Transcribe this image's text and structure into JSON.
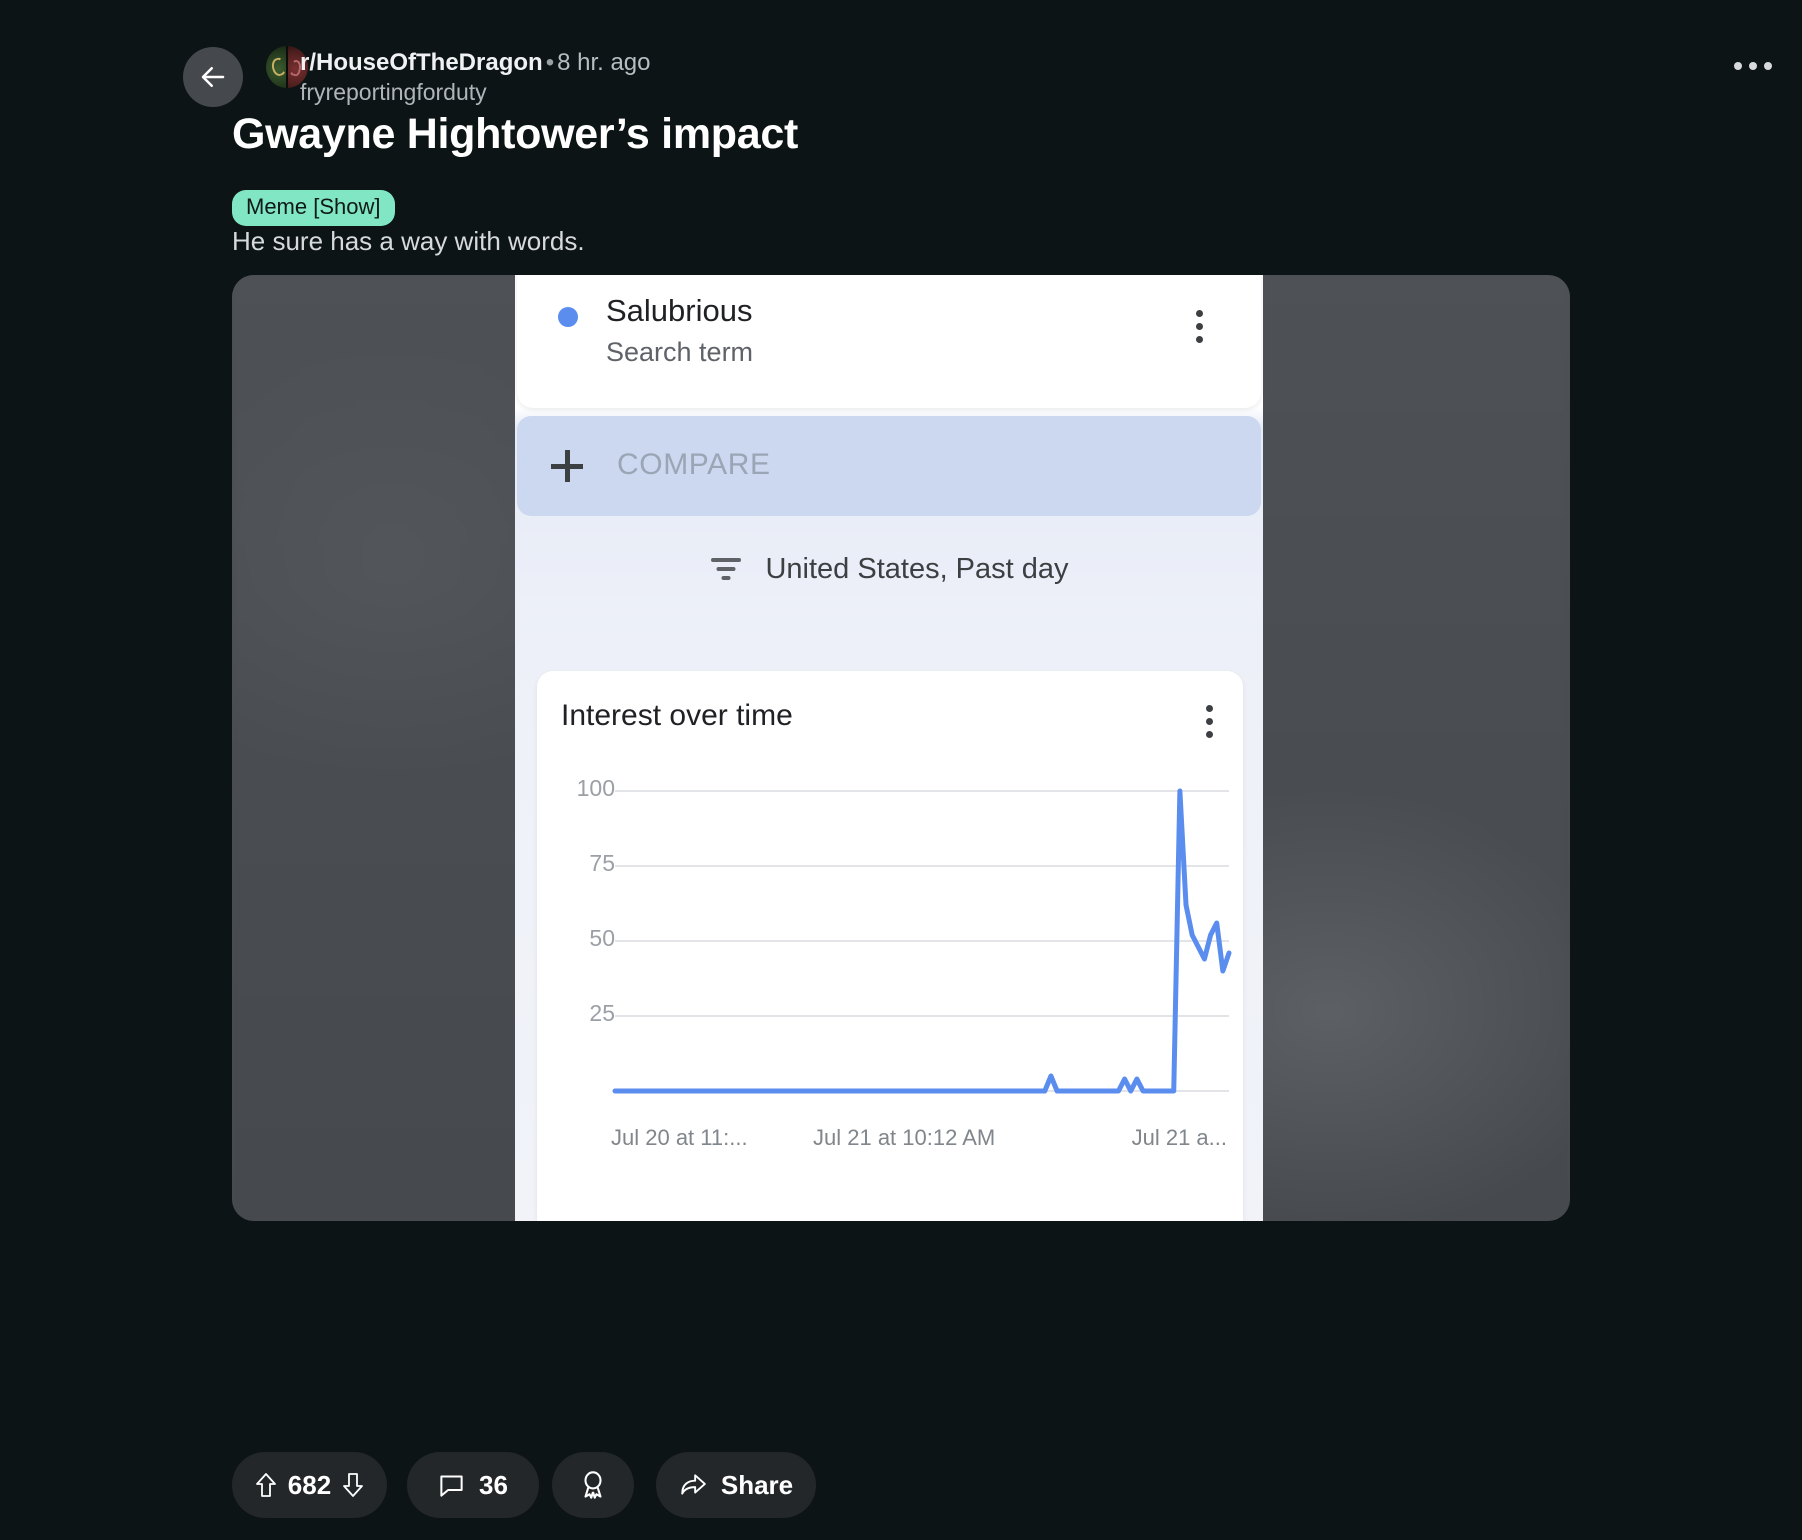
{
  "header": {
    "back_icon": "arrow-left-icon",
    "subreddit": "r/HouseOfTheDragon",
    "separator": "•",
    "age": "8 hr. ago",
    "author": "fryreportingforduty",
    "overflow_icon": "more-horizontal-icon"
  },
  "post": {
    "title": "Gwayne Hightower’s impact",
    "flair": "Meme [Show]",
    "body": "He sure has a way with words.",
    "flair_color": "#81e6c4"
  },
  "trends": {
    "term": {
      "name": "Salubrious",
      "subtitle": "Search term",
      "dot_color": "#5b8def",
      "menu_icon": "more-vertical-icon"
    },
    "compare": {
      "plus_icon": "plus-icon",
      "label": "COMPARE"
    },
    "filter": {
      "icon": "filter-icon",
      "label": "United States, Past day"
    },
    "chart_card": {
      "title": "Interest over time",
      "menu_icon": "more-vertical-icon"
    }
  },
  "chart_data": {
    "type": "line",
    "title": "Interest over time",
    "xlabel": "",
    "ylabel": "",
    "ylim": [
      0,
      100
    ],
    "yticks": [
      100,
      75,
      50,
      25
    ],
    "xticks": [
      "Jul 20 at 11:...",
      "Jul 21 at 10:12 AM",
      "Jul 21 a..."
    ],
    "grid": true,
    "legend": "Salubrious",
    "line_color": "#5b8def",
    "series": [
      {
        "name": "Salubrious",
        "values": [
          0,
          0,
          0,
          0,
          0,
          0,
          0,
          0,
          0,
          0,
          0,
          0,
          0,
          0,
          0,
          0,
          0,
          0,
          0,
          0,
          0,
          0,
          0,
          0,
          0,
          0,
          0,
          0,
          0,
          0,
          0,
          0,
          0,
          0,
          0,
          0,
          0,
          0,
          0,
          0,
          0,
          0,
          0,
          0,
          0,
          0,
          0,
          0,
          0,
          0,
          0,
          0,
          0,
          0,
          0,
          0,
          0,
          0,
          0,
          0,
          0,
          0,
          0,
          0,
          0,
          0,
          0,
          0,
          0,
          0,
          0,
          5,
          0,
          0,
          0,
          0,
          0,
          0,
          0,
          0,
          0,
          0,
          0,
          4,
          0,
          4,
          0,
          0,
          0,
          0,
          0,
          0,
          100,
          62,
          52,
          48,
          44,
          52,
          56,
          40,
          46
        ]
      }
    ]
  },
  "actions": {
    "upvote_icon": "upvote-arrow-icon",
    "score": "682",
    "downvote_icon": "downvote-arrow-icon",
    "comment_icon": "comment-bubble-icon",
    "comment_count": "36",
    "award_icon": "award-badge-icon",
    "share_icon": "share-arrow-icon",
    "share_label": "Share"
  }
}
